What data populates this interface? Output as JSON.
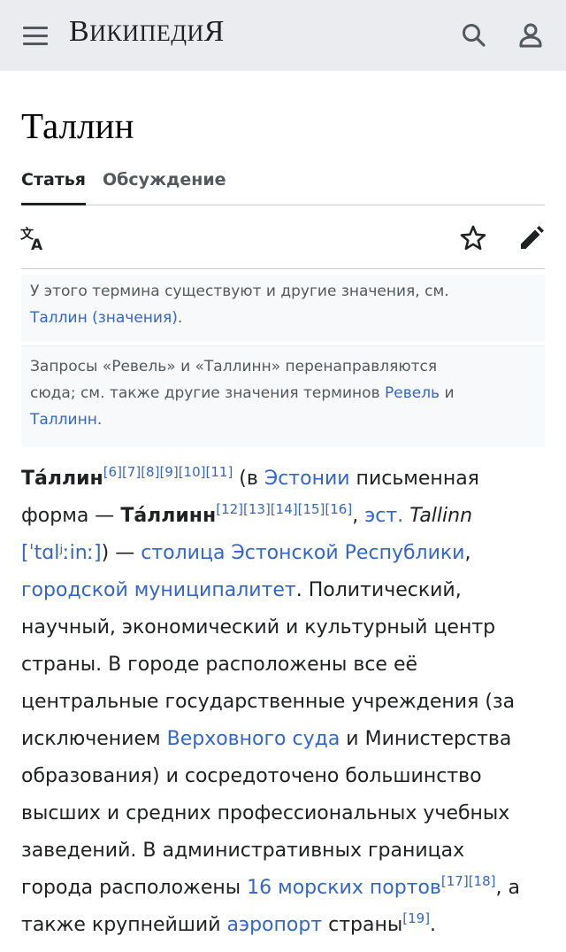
{
  "header": {
    "logo_main": "Википеди",
    "logo_last": "я",
    "logo_first_cap": "В"
  },
  "page": {
    "title": "Таллин"
  },
  "tabs": [
    {
      "label": "Статья",
      "active": true
    },
    {
      "label": "Обсуждение",
      "active": false
    }
  ],
  "toolbar": {
    "icons": [
      "language-icon",
      "star-icon",
      "edit-pencil-icon"
    ]
  },
  "hatnotes": {
    "first": {
      "text": "У этого термина существуют и другие значения, см.",
      "link": "Таллин (значения)",
      "after": "."
    },
    "second": {
      "line1": "Запросы «Ревель» и «Таллинн» перенаправляются",
      "line2_text": "сюда; см. также другие значения терминов ",
      "link1": "Ревель",
      "and": " и",
      "link2": "Таллинн",
      "after": "."
    }
  },
  "article": {
    "bold1": "Та́ллин",
    "refs1": [
      "[6]",
      "[7]",
      "[8]",
      "[9]",
      "[10]",
      "[11]"
    ],
    "t1": " (в ",
    "link_estonia": "Эстонии",
    "t2": " письменная",
    "t3": "форма — ",
    "bold2": "Та́ллинн",
    "refs2": [
      "[12]",
      "[13]",
      "[14]",
      "[15]",
      "[16]"
    ],
    "t4": ", ",
    "link_est": "эст.",
    "t5": " ",
    "latin": "Tallinn",
    "ipa": "[ˈtɑlʲːinː]",
    "t6": ") — ",
    "link_capital": "столица Эстонской Республики",
    "t7": ",",
    "link_municipality": "городской муниципалитет",
    "t8": ". Политический,",
    "l5": "научный, экономический и культурный центр",
    "l6": "страны. В городе расположены все её",
    "l7": "центральные государственные учреждения (за",
    "t9": "исключением ",
    "link_court": "Верховного суда",
    "t10": " и Министерства",
    "l9": "образования) и сосредоточено большинство",
    "l10": "высших и средних профессиональных учебных",
    "l11": "заведений. В административных границах",
    "t11": "города расположены ",
    "link_ports": "16 морских портов",
    "refs3": [
      "[17]",
      "[18]"
    ],
    "t12": ", а",
    "t13": "также крупнейший ",
    "link_airport": "аэропорт",
    "t14": " страны",
    "refs4": [
      "[19]"
    ],
    "t15": "."
  }
}
